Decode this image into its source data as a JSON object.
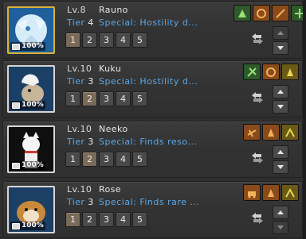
{
  "companions": [
    {
      "level": "Lv.8",
      "name": "Rauno",
      "tier_label": "Tier",
      "tier_num": "4",
      "special": "Special: Hostility d...",
      "badge": "100%",
      "levels": [
        "1",
        "2",
        "3",
        "4",
        "5"
      ],
      "selected_level": 0,
      "skills": [
        "green",
        "orange",
        "orange",
        "green"
      ]
    },
    {
      "level": "Lv.10",
      "name": "Kuku",
      "tier_label": "Tier",
      "tier_num": "3",
      "special": "Special: Hostility d...",
      "badge": "100%",
      "levels": [
        "1",
        "2",
        "3",
        "4",
        "5"
      ],
      "selected_level": 1,
      "skills": [
        "green",
        "orange",
        "yellow"
      ]
    },
    {
      "level": "Lv.10",
      "name": "Neeko",
      "tier_label": "Tier",
      "tier_num": "3",
      "special": "Special: Finds reso...",
      "badge": "100%",
      "levels": [
        "1",
        "2",
        "3",
        "4",
        "5"
      ],
      "selected_level": 1,
      "skills": [
        "orange",
        "orange",
        "yellow"
      ]
    },
    {
      "level": "Lv.10",
      "name": "Rose",
      "tier_label": "Tier",
      "tier_num": "3",
      "special": "Special: Finds rare ...",
      "badge": "100%",
      "levels": [
        "1",
        "2",
        "3",
        "4",
        "5"
      ],
      "selected_level": 0,
      "skills": [
        "orange",
        "orange",
        "yellow"
      ]
    }
  ],
  "icons": {
    "skill": "skill-icon",
    "swap": "swap-icon",
    "up": "arrow-up-icon",
    "down": "arrow-down-icon"
  }
}
